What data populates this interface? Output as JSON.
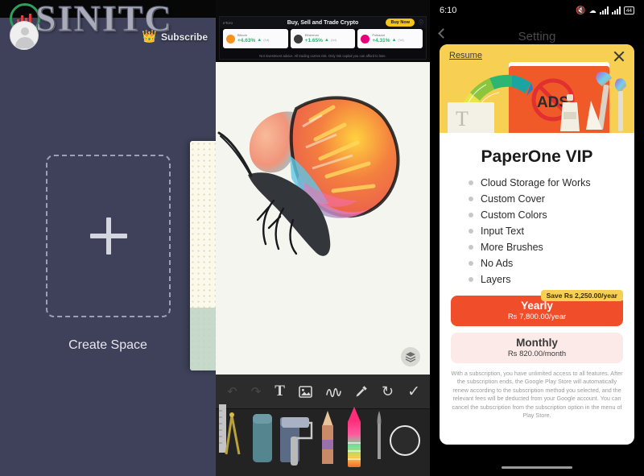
{
  "watermark": {
    "brand_text": "SINITC",
    "logo_icon": "green-circle-chart-logo",
    "avatar_icon": "user-avatar",
    "subscribe_label": "Subscribe",
    "crown_icon": "crown-icon",
    "colors": {
      "ring": "#2e9e5b",
      "bars": "#d94141",
      "crown": "#f2c230"
    }
  },
  "panel1": {
    "name": "paperone-space-list",
    "background": "#3e4159",
    "create_space": {
      "label": "Create Space",
      "plus_icon": "plus-icon"
    },
    "peek_card_name": "notebook-card-peek"
  },
  "panel2": {
    "name": "paperone-canvas",
    "ad": {
      "brand": "eToro",
      "headline": "Buy, Sell and Trade Crypto",
      "cta_label": "Buy Now",
      "info_icon": "ad-info-icon",
      "disclaimer": "Not investment advice. All trading carries risk. Only risk capital you can afford to lose.",
      "coins": [
        {
          "name": "Bitcoin",
          "change": "+4.63%",
          "volume": "(1d)",
          "color": "#f7931a",
          "symbol": "₿"
        },
        {
          "name": "Ethereum",
          "change": "+1.65%",
          "volume": "(1d)",
          "color": "#3c3c3d",
          "symbol": "♦"
        },
        {
          "name": "Polkadot",
          "change": "+4.31%",
          "volume": "(1d)",
          "color": "#e6007a",
          "symbol": "✦"
        }
      ]
    },
    "canvas": {
      "artwork_name": "watercolor-butterfly-drawing",
      "background": "#f5f5f0",
      "layers_button_name": "layers-button"
    },
    "toolbar": [
      {
        "name": "undo-icon",
        "glyph": "↶",
        "dim": true
      },
      {
        "name": "redo-left-icon",
        "glyph": "↷",
        "dim": true
      },
      {
        "name": "text-tool-icon",
        "glyph": "T",
        "dim": false
      },
      {
        "name": "image-tool-icon",
        "glyph": "ὛC",
        "dim": false
      },
      {
        "name": "smudge-tool-icon",
        "glyph": "∿",
        "dim": false
      },
      {
        "name": "eyedropper-tool-icon",
        "glyph": "✒",
        "dim": false
      },
      {
        "name": "redo-tool-icon",
        "glyph": "⟳",
        "dim": false
      },
      {
        "name": "confirm-tool-icon",
        "glyph": "✓",
        "dim": false
      }
    ],
    "brush_tray": [
      {
        "name": "ruler-compass-tool",
        "color": "#bfbfbf"
      },
      {
        "name": "eraser-tool",
        "color": "#5f8d95"
      },
      {
        "name": "marker-tool",
        "color": "#6f7f99"
      },
      {
        "name": "paint-roller-tool",
        "color": "#9aa3b8"
      },
      {
        "name": "pencil-tool",
        "color": "#c98a6a"
      },
      {
        "name": "crayon-tool-selected",
        "color": "#ff2d7a"
      },
      {
        "name": "fine-brush-tool",
        "color": "#8a8a8a"
      }
    ],
    "color_picker_name": "color-picker-ring"
  },
  "panel3": {
    "name": "paperone-vip-dialog",
    "statusbar": {
      "time": "6:10",
      "mute_icon": "mute-icon",
      "wifi_icon": "wifi-icon",
      "signal1_icon": "signal-bars-icon",
      "signal2_icon": "signal-bars-icon",
      "battery_label": "44"
    },
    "header": {
      "back_icon": "back-chevron-icon",
      "title": "Setting"
    },
    "dialog": {
      "resume_label": "Resume",
      "close_icon": "close-icon",
      "banner_icons": [
        "color-fan-icon",
        "book-icon",
        "no-ads-icon",
        "paintbrush-icon",
        "text-paper-icon",
        "spray-bottle-icon"
      ],
      "no_ads_text": "ADS",
      "title": "PaperOne VIP",
      "features": [
        "Cloud Storage for Works",
        "Custom Cover",
        "Custom Colors",
        "Input Text",
        "More Brushes",
        "No Ads",
        "Layers"
      ],
      "save_badge": "Save Rs 2,250.00/year",
      "plans": [
        {
          "name": "Yearly",
          "price": "Rs 7,800.00/year",
          "selected": true,
          "color": "#f04d2a"
        },
        {
          "name": "Monthly",
          "price": "Rs 820.00/month",
          "selected": false,
          "color": "#fceae8"
        }
      ],
      "fine_print": "With a subscription, you have unlimited access to all features. After the subscription ends, the Google Play Store will automatically renew according to the subscription method you selected, and the relevant fees will be deducted from your Google account. You can cancel the subscription from the subscription option in the menu of Play Store."
    },
    "home_indicator_name": "home-indicator"
  }
}
